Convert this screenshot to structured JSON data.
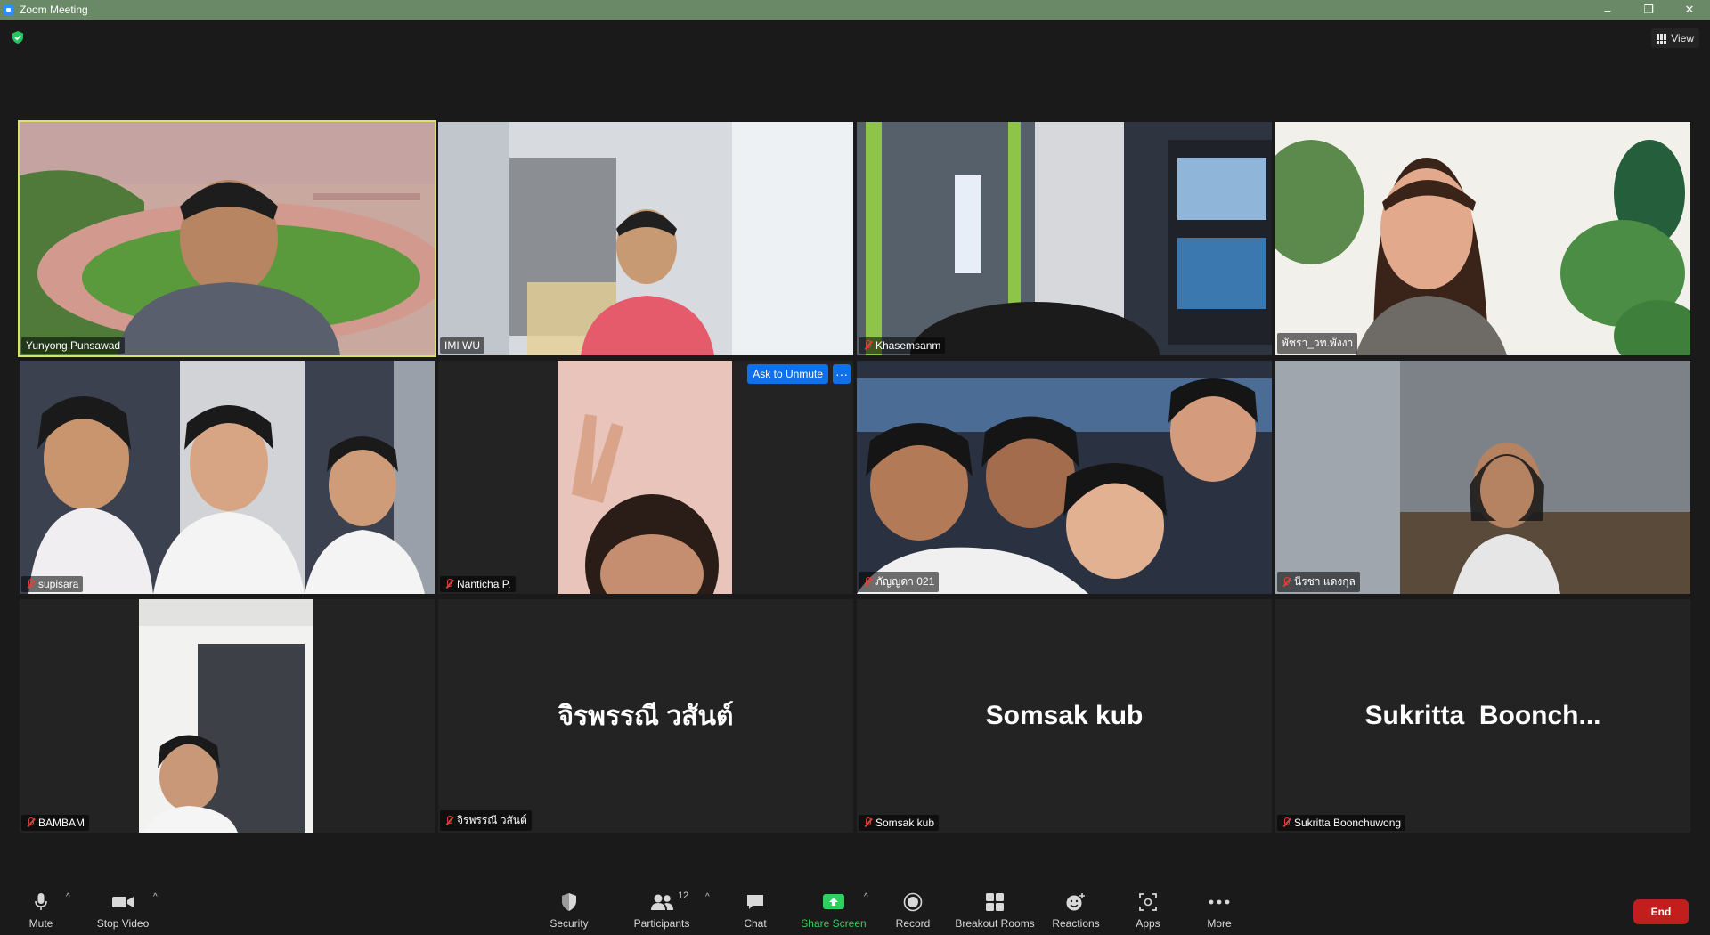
{
  "window": {
    "title": "Zoom Meeting",
    "controls": [
      "–",
      "❐",
      "✕"
    ]
  },
  "top": {
    "view_label": "View",
    "encryption_icon": "shield-check-icon"
  },
  "tiles": [
    {
      "name": "Yunyong Punsawad",
      "muted": false,
      "active": true
    },
    {
      "name": "IMI WU",
      "muted": false
    },
    {
      "name": "Khasemsanm",
      "muted": true
    },
    {
      "name": "พัชรา_วท.พังงา",
      "muted": false
    },
    {
      "name": "supisara",
      "muted": true
    },
    {
      "name": "Nanticha P.",
      "muted": true
    },
    {
      "name": "ภัญญดา 021",
      "muted": true
    },
    {
      "name": "นีรชา แดงกุล",
      "muted": true
    },
    {
      "name": "BAMBAM",
      "muted": true
    },
    {
      "name": "จิรพรรณี วสันต์",
      "muted": true,
      "display_name": "จิรพรรณี วสันต์"
    },
    {
      "name": "Somsak kub",
      "muted": true,
      "display_name": "Somsak kub"
    },
    {
      "name": "Sukritta Boonchuwong",
      "muted": true,
      "display_name": "Sukritta  Boonch..."
    }
  ],
  "tile_actions": {
    "ask_to_unmute": "Ask to Unmute",
    "more": "···"
  },
  "toolbar": {
    "mute": "Mute",
    "stop_video": "Stop Video",
    "security": "Security",
    "participants": "Participants",
    "participants_count": "12",
    "chat": "Chat",
    "share_screen": "Share Screen",
    "record": "Record",
    "breakout_rooms": "Breakout Rooms",
    "reactions": "Reactions",
    "apps": "Apps",
    "more": "More",
    "end": "End",
    "caret": "^"
  },
  "colors": {
    "titlebar": "#6a8a67",
    "active_speaker": "#d9e36b",
    "share_green": "#2cd160",
    "end_red": "#c11e1e",
    "accent_blue": "#0e71eb"
  }
}
